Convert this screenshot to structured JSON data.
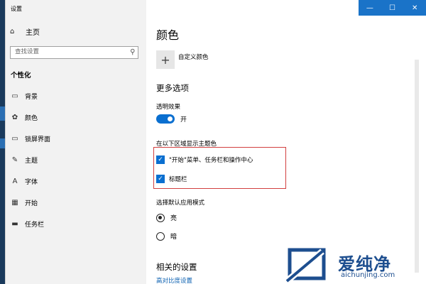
{
  "window": {
    "title": "设置",
    "controls": {
      "minimize": "—",
      "maximize": "☐",
      "close": "✕"
    }
  },
  "sidebar": {
    "home": {
      "icon": "home-icon",
      "label": "主页"
    },
    "search": {
      "placeholder": "查找设置"
    },
    "section_title": "个性化",
    "items": [
      {
        "icon": "image-icon",
        "label": "背景"
      },
      {
        "icon": "palette-icon",
        "label": "颜色"
      },
      {
        "icon": "monitor-icon",
        "label": "锁屏界面"
      },
      {
        "icon": "theme-brush-icon",
        "label": "主题"
      },
      {
        "icon": "font-icon",
        "label": "字体"
      },
      {
        "icon": "start-menu-icon",
        "label": "开始"
      },
      {
        "icon": "taskbar-icon",
        "label": "任务栏"
      }
    ]
  },
  "content": {
    "title": "颜色",
    "custom_color_label": "自定义颜色",
    "more_options_title": "更多选项",
    "transparency": {
      "label": "透明效果",
      "state_label": "开",
      "on": true
    },
    "accent_surfaces": {
      "label": "在以下区域显示主题色",
      "options": [
        {
          "label": "\"开始\"菜单、任务栏和操作中心",
          "checked": true
        },
        {
          "label": "标题栏",
          "checked": true
        }
      ]
    },
    "app_mode": {
      "label": "选择默认应用模式",
      "options": [
        {
          "label": "亮",
          "selected": true
        },
        {
          "label": "暗",
          "selected": false
        }
      ]
    },
    "related_title": "相关的设置",
    "related_link": "高对比度设置"
  },
  "watermark": {
    "brand": "爱纯净",
    "url": "aichunjing.com"
  },
  "colors": {
    "accent": "#0a6fd0",
    "titlebar_buttons": "#1a73c8",
    "highlight": "#d23f3f",
    "sidebar_bg": "#f2f2f2"
  }
}
